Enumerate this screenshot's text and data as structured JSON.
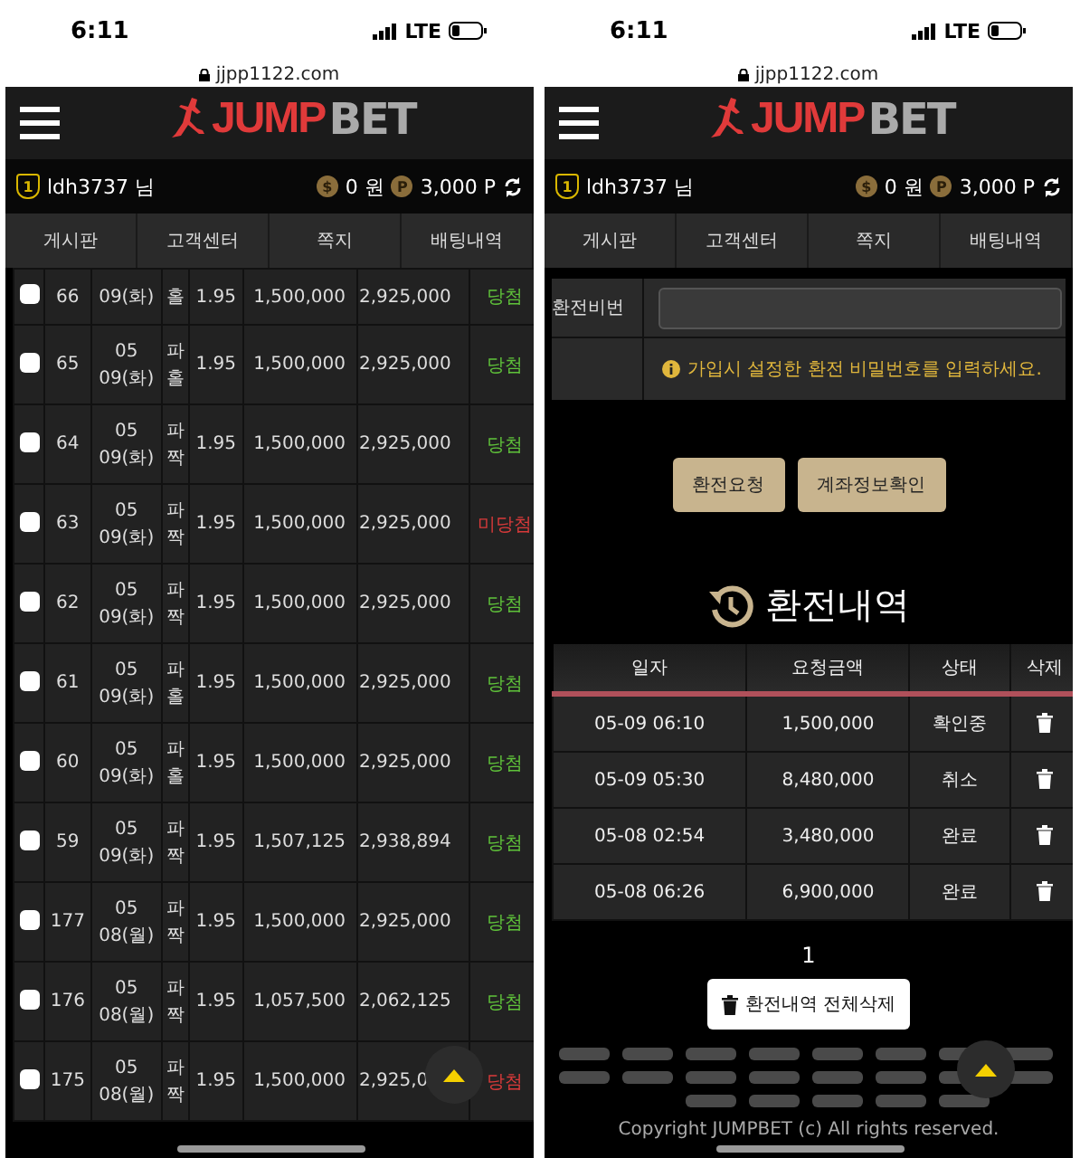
{
  "phones": [
    {
      "kind": "bets",
      "status_bar": {
        "time": "6:11",
        "network": "LTE"
      },
      "url": "jjpp1122.com",
      "logo": {
        "part_1": "JUMP",
        "part_2": "BET"
      },
      "user": {
        "level": "1",
        "name": "ldh3737 님",
        "cash_symbol": "$",
        "cash": "0 원",
        "point_symbol": "P",
        "points": "3,000 P"
      },
      "nav": [
        "게시판",
        "고객센터",
        "쪽지",
        "배팅내역"
      ],
      "bets": [
        {
          "no": "66",
          "day": "09(화)",
          "pick_2": "홀",
          "odds": "1.95",
          "amount": "1,500,000",
          "payout": "2,925,000",
          "result": "당첨",
          "won": true,
          "checked": false
        },
        {
          "no": "65",
          "month": "05",
          "day": "09(화)",
          "pick_1": "파",
          "pick_2": "홀",
          "odds": "1.95",
          "amount": "1,500,000",
          "payout": "2,925,000",
          "result": "당첨",
          "won": true,
          "checked": false
        },
        {
          "no": "64",
          "month": "05",
          "day": "09(화)",
          "pick_1": "파",
          "pick_2": "짝",
          "odds": "1.95",
          "amount": "1,500,000",
          "payout": "2,925,000",
          "result": "당첨",
          "won": true,
          "checked": false
        },
        {
          "no": "63",
          "month": "05",
          "day": "09(화)",
          "pick_1": "파",
          "pick_2": "짝",
          "odds": "1.95",
          "amount": "1,500,000",
          "payout": "2,925,000",
          "result": "미당첨",
          "won": false,
          "checked": false
        },
        {
          "no": "62",
          "month": "05",
          "day": "09(화)",
          "pick_1": "파",
          "pick_2": "짝",
          "odds": "1.95",
          "amount": "1,500,000",
          "payout": "2,925,000",
          "result": "당첨",
          "won": true,
          "checked": false
        },
        {
          "no": "61",
          "month": "05",
          "day": "09(화)",
          "pick_1": "파",
          "pick_2": "홀",
          "odds": "1.95",
          "amount": "1,500,000",
          "payout": "2,925,000",
          "result": "당첨",
          "won": true,
          "checked": false
        },
        {
          "no": "60",
          "month": "05",
          "day": "09(화)",
          "pick_1": "파",
          "pick_2": "홀",
          "odds": "1.95",
          "amount": "1,500,000",
          "payout": "2,925,000",
          "result": "당첨",
          "won": true,
          "checked": false
        },
        {
          "no": "59",
          "month": "05",
          "day": "09(화)",
          "pick_1": "파",
          "pick_2": "짝",
          "odds": "1.95",
          "amount": "1,507,125",
          "payout": "2,938,894",
          "result": "당첨",
          "won": true,
          "checked": false
        },
        {
          "no": "177",
          "month": "05",
          "day": "08(월)",
          "pick_1": "파",
          "pick_2": "짝",
          "odds": "1.95",
          "amount": "1,500,000",
          "payout": "2,925,000",
          "result": "당첨",
          "won": true,
          "checked": false
        },
        {
          "no": "176",
          "month": "05",
          "day": "08(월)",
          "pick_1": "파",
          "pick_2": "짝",
          "odds": "1.95",
          "amount": "1,057,500",
          "payout": "2,062,125",
          "result": "당첨",
          "won": true,
          "checked": false
        },
        {
          "no": "175",
          "month": "05",
          "day": "08(월)",
          "pick_1": "파",
          "pick_2": "짝",
          "odds": "1.95",
          "amount": "1,500,000",
          "payout": "2,925,0",
          "result": "당첨",
          "won": false,
          "checked": false
        }
      ]
    },
    {
      "kind": "withdraw",
      "status_bar": {
        "time": "6:11",
        "network": "LTE"
      },
      "url": "jjpp1122.com",
      "logo": {
        "part_1": "JUMP",
        "part_2": "BET"
      },
      "user": {
        "level": "1",
        "name": "ldh3737 님",
        "cash_symbol": "$",
        "cash": "0 원",
        "point_symbol": "P",
        "points": "3,000 P"
      },
      "nav": [
        "게시판",
        "고객센터",
        "쪽지",
        "배팅내역"
      ],
      "form": {
        "label": "환전비번",
        "hint": "가입시 설정한 환전 비밀번호를 입력하세요."
      },
      "buttons": [
        "환전요청",
        "계좌정보확인"
      ],
      "history": {
        "title": "환전내역",
        "columns": [
          "일자",
          "요청금액",
          "상태",
          "삭제"
        ],
        "rows": [
          {
            "date": "05-09 06:10",
            "amount": "1,500,000",
            "status": "확인중"
          },
          {
            "date": "05-09 05:30",
            "amount": "8,480,000",
            "status": "취소"
          },
          {
            "date": "05-08 02:54",
            "amount": "3,480,000",
            "status": "완료"
          },
          {
            "date": "05-08 06:26",
            "amount": "6,900,000",
            "status": "완료"
          }
        ]
      },
      "page": "1",
      "delete_all": "환전내역 전체삭제",
      "copyright": "Copyright JUMPBET (c) All rights reserved."
    }
  ]
}
